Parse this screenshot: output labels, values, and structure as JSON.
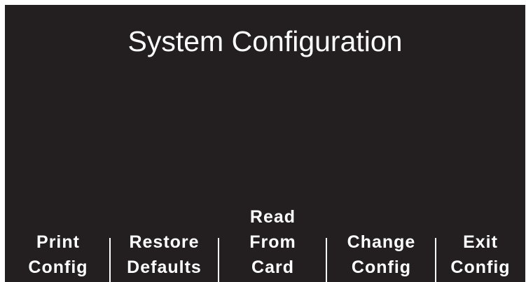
{
  "screen": {
    "title": "System Configuration"
  },
  "softkeys": [
    {
      "line1": "",
      "line2": "Print",
      "line3": "Config"
    },
    {
      "line1": "",
      "line2": "Restore",
      "line3": "Defaults"
    },
    {
      "line1": "Read",
      "line2": "From",
      "line3": "Card"
    },
    {
      "line1": "",
      "line2": "Change",
      "line3": "Config"
    },
    {
      "line1": "",
      "line2": "Exit",
      "line3": "Config"
    }
  ],
  "colors": {
    "background": "#231f20",
    "text": "#ffffff",
    "border": "#ffffff"
  }
}
